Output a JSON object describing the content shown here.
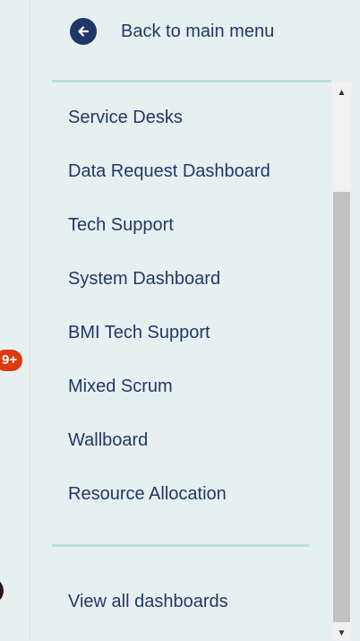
{
  "back": {
    "label": "Back to main menu",
    "icon": "arrow-left-icon"
  },
  "menu": {
    "items": [
      "Service Desks",
      "Data Request Dashboard",
      "Tech Support",
      "System Dashboard",
      "BMI Tech Support",
      "Mixed Scrum",
      "Wallboard",
      "Resource Allocation"
    ]
  },
  "footer": {
    "view_all": "View all dashboards"
  },
  "notification": {
    "badge": "9+"
  },
  "colors": {
    "text": "#233766",
    "icon_bg": "#1f3768",
    "divider": "#bcdde2",
    "badge": "#dc3a0e",
    "panel_bg": "#e7f0f1"
  }
}
